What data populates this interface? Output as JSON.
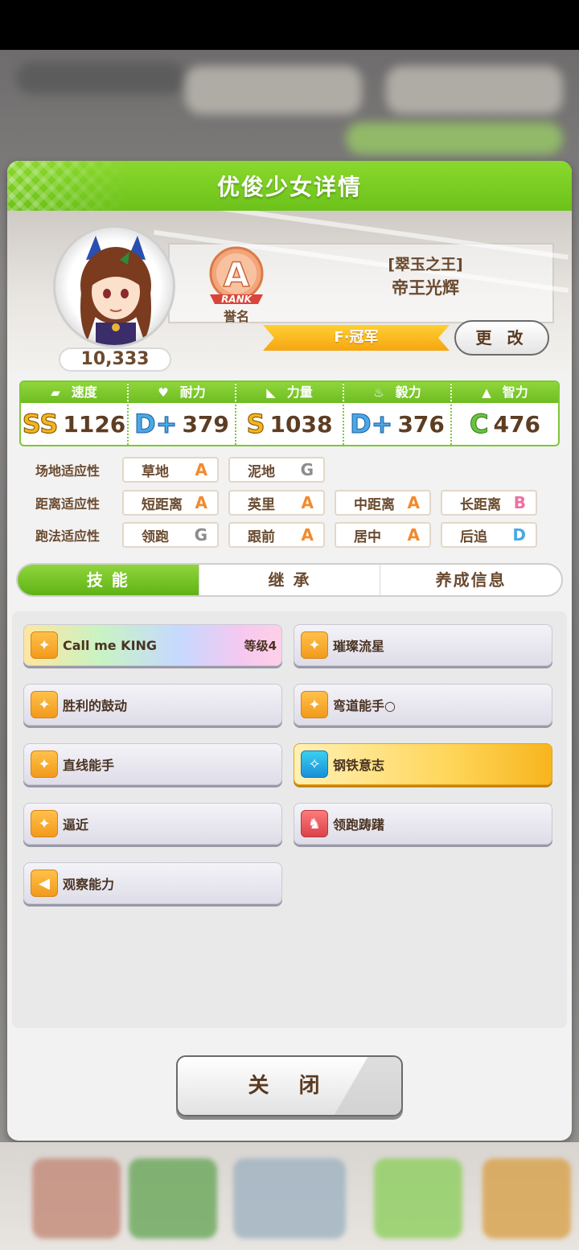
{
  "dialog": {
    "title": "优俊少女详情"
  },
  "character": {
    "fans": "10,333",
    "rank_badge": "A",
    "rank_word": "RANK",
    "rank_label": "誉名",
    "epithet": "[翠玉之王]",
    "name": "帝王光辉",
    "title_banner": "F·冠军",
    "change_label": "更 改"
  },
  "stats": [
    {
      "label": "速度",
      "icon": "shoe-icon",
      "grade": "SS",
      "value": "1126"
    },
    {
      "label": "耐力",
      "icon": "heart-icon",
      "grade": "D+",
      "value": "379"
    },
    {
      "label": "力量",
      "icon": "muscle-icon",
      "grade": "S",
      "value": "1038"
    },
    {
      "label": "毅力",
      "icon": "flame-icon",
      "grade": "D+",
      "value": "376"
    },
    {
      "label": "智力",
      "icon": "graduation-cap-icon",
      "grade": "C",
      "value": "476"
    }
  ],
  "aptitude": {
    "track": {
      "label": "场地适应性",
      "items": [
        {
          "name": "草地",
          "grade": "A"
        },
        {
          "name": "泥地",
          "grade": "G"
        }
      ]
    },
    "distance": {
      "label": "距离适应性",
      "items": [
        {
          "name": "短距离",
          "grade": "A"
        },
        {
          "name": "英里",
          "grade": "A"
        },
        {
          "name": "中距离",
          "grade": "A"
        },
        {
          "name": "长距离",
          "grade": "B"
        }
      ]
    },
    "style": {
      "label": "跑法适应性",
      "items": [
        {
          "name": "领跑",
          "grade": "G"
        },
        {
          "name": "跟前",
          "grade": "A"
        },
        {
          "name": "居中",
          "grade": "A"
        },
        {
          "name": "后追",
          "grade": "D"
        }
      ]
    }
  },
  "tabs": [
    {
      "label": "技 能",
      "active": true
    },
    {
      "label": "继 承",
      "active": false
    },
    {
      "label": "养成信息",
      "active": false
    }
  ],
  "skills": [
    {
      "name": "Call me KING",
      "level": "等级4",
      "style": "rainbow",
      "icon": "runner-icon"
    },
    {
      "name": "璀璨流星",
      "style": "normal",
      "icon": "runner-icon"
    },
    {
      "name": "胜利的鼓动",
      "style": "normal",
      "icon": "runner-icon"
    },
    {
      "name": "弯道能手○",
      "style": "normal",
      "icon": "runner-icon"
    },
    {
      "name": "直线能手",
      "style": "normal",
      "icon": "runner-icon"
    },
    {
      "name": "钢铁意志",
      "style": "gold",
      "icon": "sparkle-icon"
    },
    {
      "name": "逼近",
      "style": "normal",
      "icon": "runner-icon"
    },
    {
      "name": "领跑踌躇",
      "style": "normal",
      "icon": "horse-icon"
    },
    {
      "name": "观察能力",
      "style": "normal",
      "icon": "megaphone-icon"
    }
  ],
  "close_label": "关 闭",
  "colors": {
    "header_green": "#6cc21a",
    "text_brown": "#6a4a2f",
    "banner_gold": "#f5a612"
  }
}
